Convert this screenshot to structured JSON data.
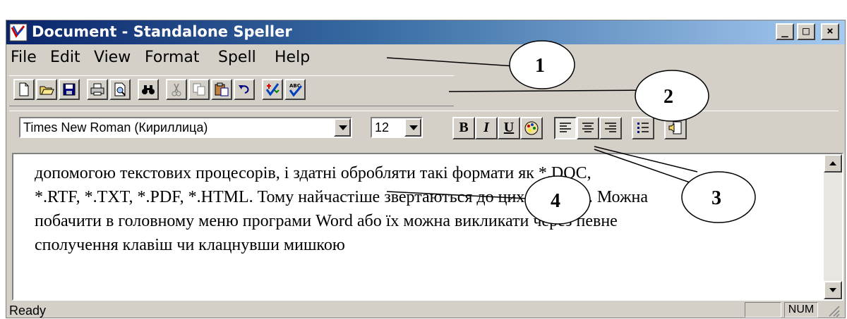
{
  "window": {
    "title": "Document - Standalone Speller",
    "controls": {
      "minimize": "_",
      "maximize": "□",
      "close": "×"
    }
  },
  "menu": {
    "items": [
      {
        "label": "File"
      },
      {
        "label": "Edit"
      },
      {
        "label": "View"
      },
      {
        "label": "Format"
      },
      {
        "label": "Spell"
      },
      {
        "label": "Help"
      }
    ]
  },
  "toolbar": {
    "icons": [
      "new-document-icon",
      "open-folder-icon",
      "save-icon",
      "print-icon",
      "print-preview-icon",
      "find-icon",
      "cut-icon",
      "copy-icon",
      "paste-icon",
      "undo-icon",
      "spell-check-icon",
      "spell-abc-icon"
    ]
  },
  "format_toolbar": {
    "font": "Times New Roman (Кириллица)",
    "size": "12",
    "bold": "B",
    "italic": "I",
    "underline": "U"
  },
  "editor": {
    "lines": [
      "допомогою текстових процесорів, і здатні обробляти такі формати як *.DOC,",
      "*.RTF, *.TXT, *.PDF, *.HTML. Тому найчастіше звертаються до цих програм. Можна",
      "побачити в головному меню програми Word або їх можна викликати через певне",
      "сполучення клавіш чи клацнувши мишкою"
    ]
  },
  "status": {
    "text": "Ready",
    "num": "NUM"
  },
  "callouts": [
    {
      "label": "1"
    },
    {
      "label": "2"
    },
    {
      "label": "3"
    },
    {
      "label": "4"
    }
  ],
  "colors": {
    "title_gradient_start": "#0a246a",
    "title_gradient_end": "#a6caf0",
    "chrome": "#d4d0c8"
  }
}
